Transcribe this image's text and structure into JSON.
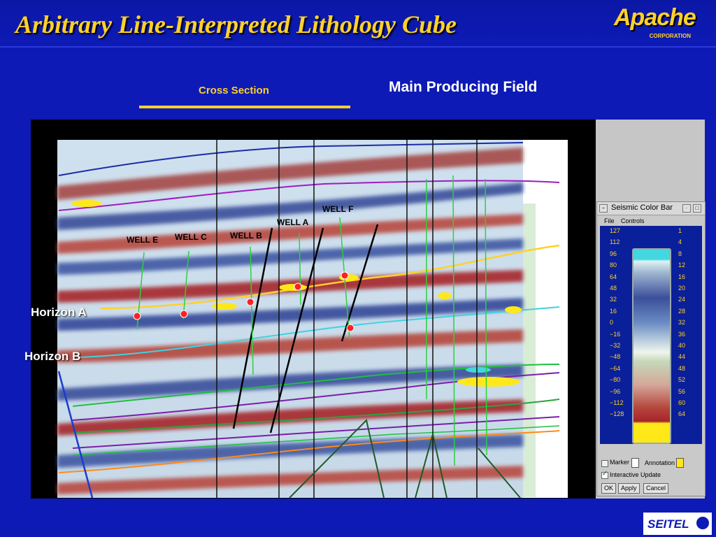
{
  "title": "Arbitrary Line-Interpreted Lithology Cube",
  "logo": {
    "main": "Apache",
    "sub": "CORPORATION"
  },
  "cross_section_label": "Cross Section",
  "field_label": "Main Producing Field",
  "wells": [
    "WELL E",
    "WELL C",
    "WELL B",
    "WELL A",
    "WELL F"
  ],
  "horizons": [
    "Horizon A",
    "Horizon B"
  ],
  "color_bar": {
    "title": "Seismic Color Bar",
    "menu": [
      "File",
      "Controls"
    ],
    "left_scale": [
      "127",
      "112",
      "96",
      "80",
      "64",
      "48",
      "32",
      "16",
      "0",
      "−16",
      "−32",
      "−48",
      "−64",
      "−80",
      "−96",
      "−112",
      "−128"
    ],
    "right_scale": [
      "1",
      "4",
      "8",
      "12",
      "16",
      "20",
      "24",
      "28",
      "32",
      "36",
      "40",
      "44",
      "48",
      "52",
      "56",
      "60",
      "64"
    ],
    "marker_label": "Marker",
    "annotation_label": "Annotation",
    "interactive_label": "Interactive Update",
    "ok_label": "OK",
    "apply_label": "Apply",
    "cancel_label": "Cancel",
    "colors": {
      "top": "#43d7e0",
      "bottom": "#ffe81a"
    }
  },
  "footer_logo": "SEITEL"
}
